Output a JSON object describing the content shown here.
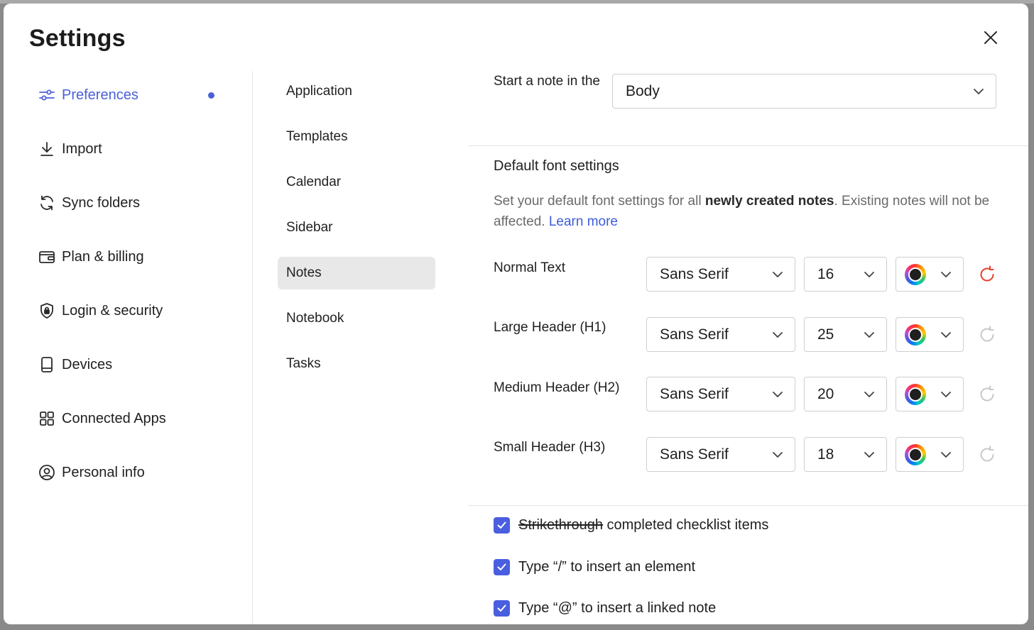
{
  "modal": {
    "title": "Settings"
  },
  "nav": {
    "items": [
      {
        "label": "Preferences",
        "icon": "sliders-icon",
        "active": true
      },
      {
        "label": "Import",
        "icon": "download-icon"
      },
      {
        "label": "Sync folders",
        "icon": "sync-icon"
      },
      {
        "label": "Plan & billing",
        "icon": "wallet-icon"
      },
      {
        "label": "Login & security",
        "icon": "shield-lock-icon"
      },
      {
        "label": "Devices",
        "icon": "phone-icon"
      },
      {
        "label": "Connected Apps",
        "icon": "grid-icon"
      },
      {
        "label": "Personal info",
        "icon": "user-circle-icon"
      }
    ]
  },
  "subnav": {
    "items": [
      {
        "label": "Application"
      },
      {
        "label": "Templates"
      },
      {
        "label": "Calendar"
      },
      {
        "label": "Sidebar"
      },
      {
        "label": "Notes",
        "active": true
      },
      {
        "label": "Notebook"
      },
      {
        "label": "Tasks"
      }
    ]
  },
  "notes": {
    "start_label": "Start a note in the",
    "start_value": "Body",
    "font_section_title": "Default font settings",
    "desc_prefix": "Set your default font settings for all ",
    "desc_bold": "newly created notes",
    "desc_suffix": ". Existing notes will not be affected. ",
    "learn_more": "Learn more",
    "font_rows": [
      {
        "label": "Normal Text",
        "font": "Sans Serif",
        "size": "16",
        "reset_active": true
      },
      {
        "label": "Large Header (H1)",
        "font": "Sans Serif",
        "size": "25",
        "reset_active": false
      },
      {
        "label": "Medium Header (H2)",
        "font": "Sans Serif",
        "size": "20",
        "reset_active": false
      },
      {
        "label": "Small Header (H3)",
        "font": "Sans Serif",
        "size": "18",
        "reset_active": false
      }
    ],
    "checkboxes": [
      {
        "strike_part": "Strikethrough",
        "rest": " completed checklist items",
        "checked": true
      },
      {
        "strike_part": "",
        "rest": "Type “/” to insert an element",
        "checked": true
      },
      {
        "strike_part": "",
        "rest": "Type “@” to insert a linked note",
        "checked": true
      }
    ]
  },
  "colors": {
    "accent": "#4a60d8",
    "reset_active": "#e5402e",
    "reset_inactive": "#c8c8c8"
  }
}
